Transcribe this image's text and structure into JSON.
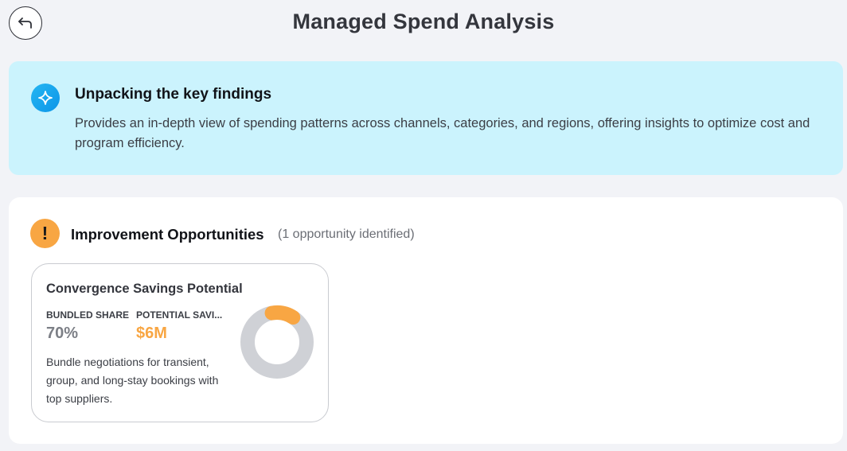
{
  "header": {
    "title": "Managed Spend Analysis",
    "back_icon": "back-arrow-icon"
  },
  "banner": {
    "icon": "sparkle-icon",
    "heading": "Unpacking the key findings",
    "text": "Provides an in-depth view of spending patterns across channels, categories, and regions, offering insights to optimize cost and program efficiency."
  },
  "improvements": {
    "icon": "exclamation-icon",
    "heading": "Improvement Opportunities",
    "count_text": "(1 opportunity identified)",
    "card": {
      "title": "Convergence Savings Potential",
      "metric1_label": "BUNDLED SHARE",
      "metric1_value": "70%",
      "metric2_label": "POTENTIAL SAVI...",
      "metric2_value": "$6M",
      "description": "Bundle negotiations for transient, group, and long-stay bookings with top suppliers.",
      "donut_fraction": 0.12
    }
  },
  "colors": {
    "accent_orange": "#f8a643",
    "banner_bg": "#cbf3fd",
    "donut_track": "#cfd1d6",
    "page_bg": "#f2f3f7"
  }
}
